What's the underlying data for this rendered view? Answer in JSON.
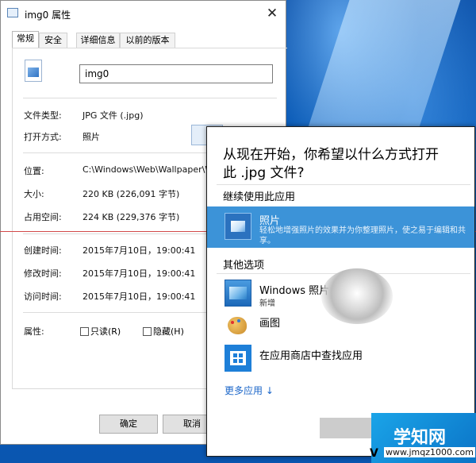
{
  "dialog": {
    "title": "img0 属性",
    "close_glyph": "✕",
    "tabs": [
      "常规",
      "安全",
      "详细信息",
      "以前的版本"
    ],
    "file_name": "img0",
    "file_type_label": "文件类型:",
    "file_type_value": "JPG 文件 (.jpg)",
    "open_with_label": "打开方式:",
    "open_with_value": "照片",
    "location_label": "位置:",
    "location_value": "C:\\Windows\\Web\\Wallpaper\\Wi",
    "size_label": "大小:",
    "size_value": "220 KB (226,091 字节)",
    "disk_size_label": "占用空间:",
    "disk_size_value": "224 KB (229,376 字节)",
    "created_label": "创建时间:",
    "created_value": "2015年7月10日，19:00:41",
    "modified_label": "修改时间:",
    "modified_value": "2015年7月10日，19:00:41",
    "accessed_label": "访问时间:",
    "accessed_value": "2015年7月10日，19:00:41",
    "attributes_label": "属性:",
    "readonly_label": "只读(R)",
    "hidden_label": "隐藏(H)",
    "ok_label": "确定",
    "cancel_label": "取消"
  },
  "flyout": {
    "question_line1": "从现在开始，你希望以什么方式打开",
    "question_line2": "此 .jpg 文件?",
    "keep_section": "继续使用此应用",
    "selected_app": {
      "name": "照片",
      "description": "轻松地增强照片的效果并为你整理照片，使之易于编辑和共享。",
      "icon": "photos-icon"
    },
    "other_section": "其他选项",
    "apps": [
      {
        "name": "Windows 照片",
        "sub": "新增",
        "icon": "windows-photo-viewer-icon"
      },
      {
        "name": "画图",
        "sub": "",
        "icon": "paint-icon"
      },
      {
        "name": "在应用商店中查找应用",
        "sub": "",
        "icon": "store-icon"
      }
    ],
    "more_apps": "更多应用 ↓"
  },
  "watermark": {
    "site_name": "学知网",
    "site_url": "www.jmqz1000.com",
    "leading_char": "V"
  },
  "colors": {
    "selection": "#3c93d8",
    "link": "#1b66c9",
    "wallpaper": "#0b5fb6"
  }
}
